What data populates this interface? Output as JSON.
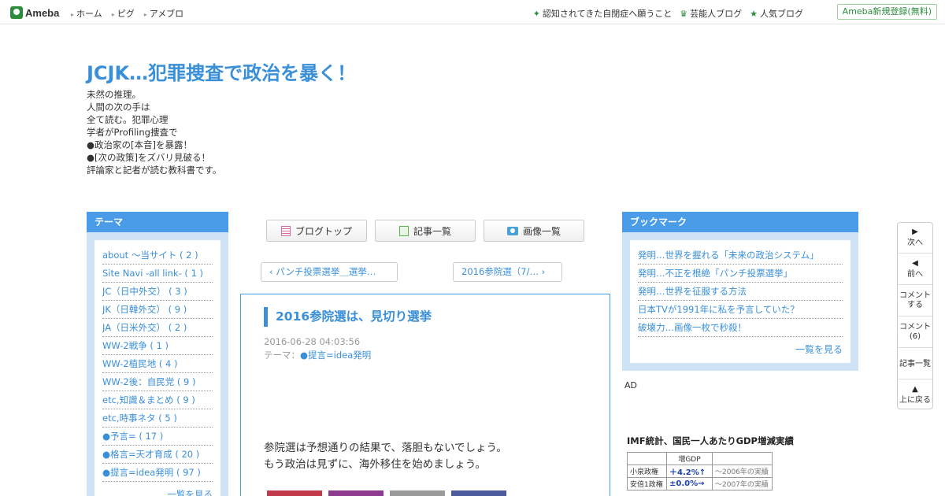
{
  "topbar": {
    "logo": "Ameba",
    "nav": [
      "ホーム",
      "ピグ",
      "アメブロ"
    ],
    "right_links": [
      {
        "icon": "sparkle-icon",
        "label": "認知されてきた自閉症へ願うこと"
      },
      {
        "icon": "crown-icon",
        "label": "芸能人ブログ"
      },
      {
        "icon": "star-icon",
        "label": "人気ブログ"
      }
    ],
    "signup": "Ameba新規登録(無料)"
  },
  "header": {
    "title": "JCJK…犯罪捜査で政治を暴く！",
    "description": [
      "未然の推理。",
      "人間の次の手は",
      "全て読む。犯罪心理",
      "学者がProfiling捜査で",
      "●政治家の[本音]を暴露！",
      "●[次の政策]をズバリ見破る！",
      "評論家と記者が読む教科書です。"
    ]
  },
  "theme": {
    "heading": "テーマ",
    "items": [
      "about ～当サイト ( 2 )",
      "Site Navi -all link- ( 1 )",
      "JC（日中外交） ( 3 )",
      "JK（日韓外交） ( 9 )",
      "JA（日米外交） ( 2 )",
      "WW-2戦争 ( 1 )",
      "WW-2植民地 ( 4 )",
      "WW-2後：自民党 ( 9 )",
      "etc,知識＆まとめ ( 9 )",
      "etc,時事ネタ ( 5 )",
      "●予言= ( 17 )",
      "●格言=天才育成 ( 20 )",
      "●提言=idea発明 ( 97 )"
    ],
    "more": "一覧を見る"
  },
  "buttons": {
    "blog_top": "ブログトップ",
    "article_list": "記事一覧",
    "image_list": "画像一覧"
  },
  "pager": {
    "prev": "パンチ投票選挙＿選挙…",
    "next": "2016参院選（7/…"
  },
  "article": {
    "title": "2016参院選は、見切り選挙",
    "date": "2016-06-28 04:03:56",
    "theme_label": "テーマ：",
    "theme": "●提言=idea発明",
    "body": [
      "参院選は予想通りの結果で、落胆もないでしょう。",
      "もう政治は見ずに、海外移住を始めましょう。"
    ],
    "image_colors": [
      "#c0394b",
      "#8e3a8e",
      "#9a9a9a",
      "#4a5a9a"
    ]
  },
  "bookmark": {
    "heading": "ブックマーク",
    "items": [
      "発明…世界を握れる「未来の政治システム」",
      "発明…不正を根絶「パンチ投票選挙」",
      "発明…世界を征服する方法",
      "日本TVが1991年に私を予言していた？",
      "破壊力…画像一枚で秒殺！"
    ],
    "more": "一覧を見る"
  },
  "ad": {
    "label": "AD",
    "title": "IMF統計、国民一人あたりGDP増減実績",
    "header_cell": "増GDP",
    "rows": [
      {
        "name": "小泉政権",
        "value": "＋4.2%↑",
        "note": "～2006年の実績"
      },
      {
        "name": "安倍1政権",
        "value": "±0.0%→",
        "note": "～2007年の実績"
      }
    ]
  },
  "float_nav": {
    "next": "次へ",
    "prev": "前へ",
    "comment_line1": "コメント",
    "comment_line2": "する",
    "comments_line1": "コメント",
    "comments_count": "(6)",
    "article_list": "記事一覧",
    "back_top": "上に戻る"
  }
}
